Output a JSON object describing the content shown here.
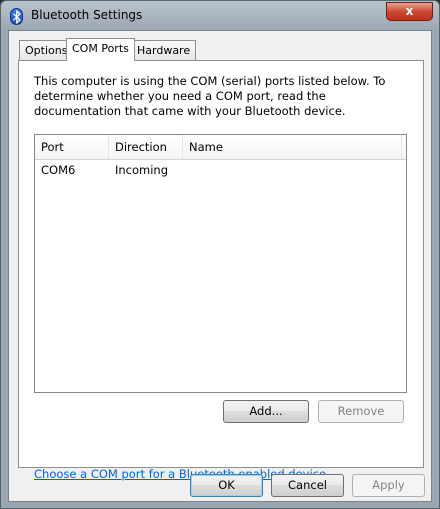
{
  "window": {
    "title": "Bluetooth Settings",
    "close_glyph": "x"
  },
  "tabs": [
    {
      "label": "Options"
    },
    {
      "label": "COM Ports"
    },
    {
      "label": "Hardware"
    }
  ],
  "panel": {
    "intro_text": "This computer is using the COM (serial) ports listed below. To determine whether you need a COM port, read the documentation that came with your Bluetooth device.",
    "columns": [
      "Port",
      "Direction",
      "Name"
    ],
    "rows": [
      {
        "port": "COM6",
        "direction": "Incoming",
        "name": ""
      }
    ],
    "add_label": "Add...",
    "remove_label": "Remove",
    "link_text": "Choose a COM port for a Bluetooth enabled device."
  },
  "footer": {
    "ok_label": "OK",
    "cancel_label": "Cancel",
    "apply_label": "Apply"
  },
  "icons": {
    "app": "bluetooth-icon",
    "close": "close-icon"
  }
}
